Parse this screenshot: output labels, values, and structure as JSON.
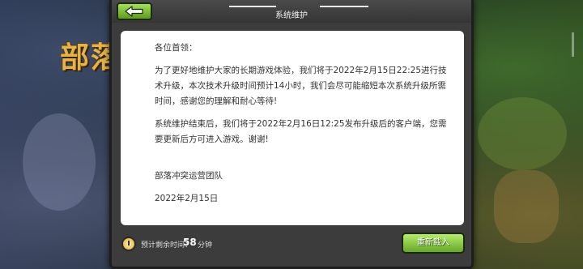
{
  "background": {
    "title": "部落"
  },
  "dialog": {
    "title": "系统维护",
    "back_icon": "back-arrow-icon",
    "greeting": "各位首领：",
    "paragraph1": "为了更好地维护大家的长期游戏体验，我们将于2022年2月15日22:25进行技术升级，本次技术升级时间预计14小时，我们会尽可能缩短本次系统升级所需时间，感谢您的理解和耐心等待!",
    "paragraph2": "系统维护结束后，我们将于2022年2月16日12:25发布升级后的客户端，您需要更新后方可进入游戏。谢谢!",
    "signature": "部落冲突运营团队",
    "date": "2022年2月15日"
  },
  "footer": {
    "timer_label": "预计剩余时间：",
    "timer_value": "58",
    "timer_unit": "分钟",
    "reload_label": "重新载入"
  },
  "colors": {
    "accent_green": "#7cc43a",
    "dialog_bg": "#3c3c3c"
  }
}
